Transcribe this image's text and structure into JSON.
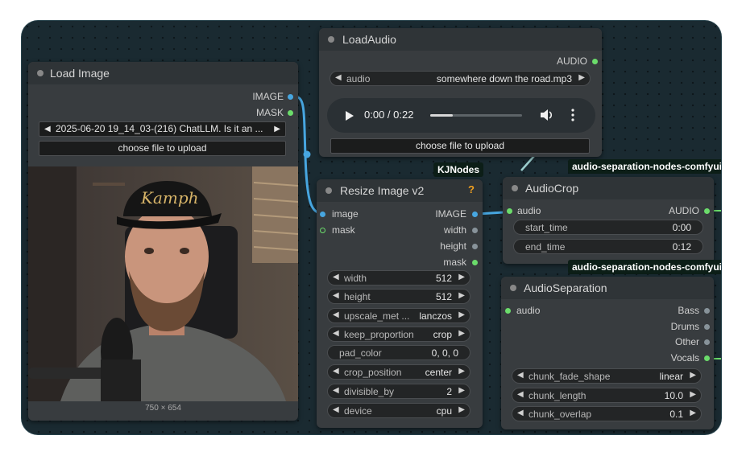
{
  "load_image": {
    "title": "Load Image",
    "outputs": {
      "image": "IMAGE",
      "mask": "MASK"
    },
    "file_value": "2025-06-20 19_14_03-(216) ChatLLM. Is it an ...",
    "upload_label": "choose file to upload",
    "preview_size": "750 × 654"
  },
  "load_audio": {
    "title": "LoadAudio",
    "output": "AUDIO",
    "audio_label": "audio",
    "audio_value": "somewhere down the road.mp3",
    "player_time": "0:00 / 0:22",
    "upload_label": "choose file to upload"
  },
  "resize": {
    "badge": "KJNodes",
    "title": "Resize Image v2",
    "help": "?",
    "inputs": {
      "image": "image",
      "mask": "mask"
    },
    "outputs": {
      "image": "IMAGE",
      "width": "width",
      "height": "height",
      "mask": "mask"
    },
    "widgets": [
      {
        "label": "width",
        "value": "512"
      },
      {
        "label": "height",
        "value": "512"
      },
      {
        "label": "upscale_met ...",
        "value": "lanczos"
      },
      {
        "label": "keep_proportion",
        "value": "crop"
      },
      {
        "label": "pad_color",
        "value": "0, 0, 0"
      },
      {
        "label": "crop_position",
        "value": "center"
      },
      {
        "label": "divisible_by",
        "value": "2"
      },
      {
        "label": "device",
        "value": "cpu"
      }
    ]
  },
  "audio_crop": {
    "badge": "audio-separation-nodes-comfyui",
    "title": "AudioCrop",
    "input": "audio",
    "output": "AUDIO",
    "widgets": [
      {
        "label": "start_time",
        "value": "0:00"
      },
      {
        "label": "end_time",
        "value": "0:12"
      }
    ]
  },
  "audio_sep": {
    "badge": "audio-separation-nodes-comfyui",
    "title": "AudioSeparation",
    "input": "audio",
    "outputs": {
      "bass": "Bass",
      "drums": "Drums",
      "other": "Other",
      "vocals": "Vocals"
    },
    "widgets": [
      {
        "label": "chunk_fade_shape",
        "value": "linear"
      },
      {
        "label": "chunk_length",
        "value": "10.0"
      },
      {
        "label": "chunk_overlap",
        "value": "0.1"
      }
    ]
  },
  "colors": {
    "canvas": "#1a2a31",
    "link": "#47a6e0",
    "badge_bg": "#0c1e17",
    "help": "#f0a020"
  },
  "icons": [
    "play-icon",
    "volume-icon",
    "more-options-icon",
    "arrow-left-icon",
    "arrow-right-icon"
  ]
}
